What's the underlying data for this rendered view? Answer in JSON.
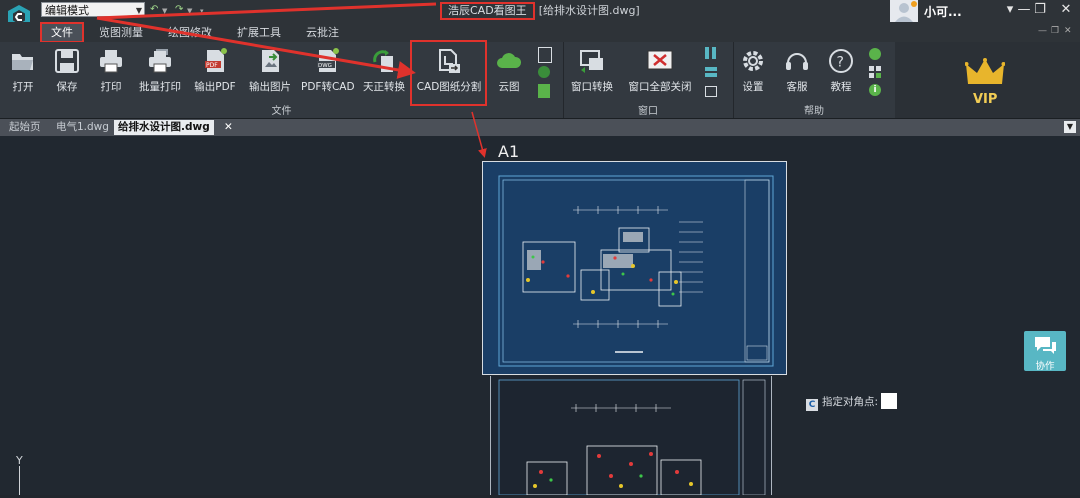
{
  "window": {
    "mode": "编辑模式",
    "title": "浩辰CAD看图王",
    "filename": "[给排水设计图.dwg]",
    "user": "小可..."
  },
  "menu": [
    "文件",
    "览图测量",
    "绘图修改",
    "扩展工具",
    "云批注"
  ],
  "ribbon": {
    "file_tools": [
      {
        "label": "打开",
        "icon": "folder-open-icon"
      },
      {
        "label": "保存",
        "icon": "save-icon"
      },
      {
        "label": "打印",
        "icon": "printer-icon"
      },
      {
        "label": "批量打印",
        "icon": "batch-print-icon"
      },
      {
        "label": "输出PDF",
        "icon": "pdf-export-icon"
      },
      {
        "label": "输出图片",
        "icon": "image-export-icon"
      },
      {
        "label": "PDF转CAD",
        "icon": "pdf-to-cad-icon"
      },
      {
        "label": "天正转换",
        "icon": "tangent-convert-icon"
      },
      {
        "label": "CAD图纸分割",
        "icon": "drawing-split-icon"
      },
      {
        "label": "云图",
        "icon": "cloud-icon"
      }
    ],
    "file_group_label": "文件",
    "window_tools": [
      {
        "label": "窗口转换",
        "icon": "window-switch-icon"
      },
      {
        "label": "窗口全部关闭",
        "icon": "close-all-windows-icon"
      }
    ],
    "window_group_label": "窗口",
    "help_tools": [
      {
        "label": "设置",
        "icon": "gear-icon"
      },
      {
        "label": "客服",
        "icon": "headset-icon"
      },
      {
        "label": "教程",
        "icon": "help-icon"
      }
    ],
    "help_group_label": "帮助",
    "vip": "VIP"
  },
  "tabs": [
    "起始页",
    "电气1.dwg",
    "给排水设计图.dwg"
  ],
  "canvas": {
    "sheet_label": "A1",
    "prompt": "指定对角点:",
    "collab": "协作",
    "axis_y": "Y"
  },
  "colors": {
    "highlight": "#e0322c",
    "accent": "#58b7c4",
    "vip_gold": "#e8b52c",
    "sheet_blue": "#1a3e66"
  }
}
